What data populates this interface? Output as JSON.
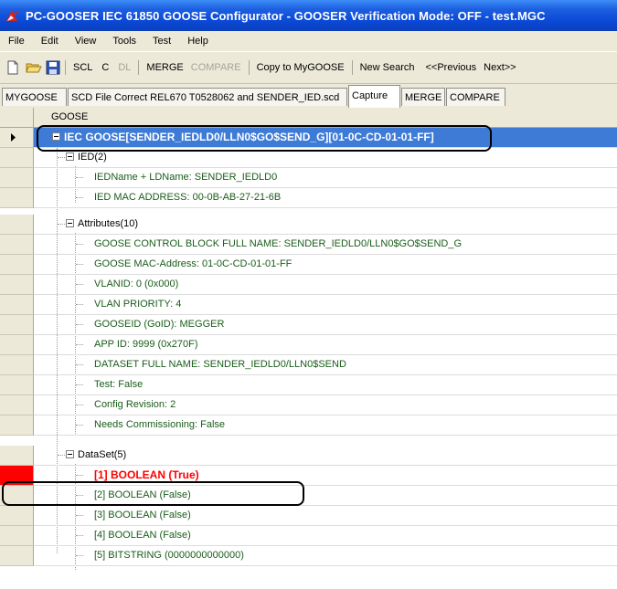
{
  "window": {
    "title": "PC-GOOSER  IEC 61850 GOOSE Configurator - GOOSER Verification Mode: OFF - test.MGC"
  },
  "menu": [
    "File",
    "Edit",
    "View",
    "Tools",
    "Test",
    "Help"
  ],
  "toolbar": {
    "scl": "SCL",
    "c": "C",
    "dl": "DL",
    "merge": "MERGE",
    "compare": "COMPARE",
    "copy": "Copy to MyGOOSE",
    "new_search": "New Search",
    "prev": "<<Previous",
    "next": "Next>>"
  },
  "tabs": [
    "MYGOOSE",
    "SCD File Correct REL670 T0528062 and SENDER_IED.scd",
    "Capture",
    "MERGE",
    "COMPARE"
  ],
  "active_tab": "Capture",
  "grid": {
    "column_header": "GOOSE",
    "root": "IEC GOOSE[SENDER_IEDLD0/LLN0$GO$SEND_G][01-0C-CD-01-01-FF]",
    "ied_group": "IED(2)",
    "ied_items": [
      "IEDName + LDName: SENDER_IEDLD0",
      "IED MAC ADDRESS: 00-0B-AB-27-21-6B"
    ],
    "attr_group": "Attributes(10)",
    "attr_items": [
      "GOOSE CONTROL BLOCK FULL NAME: SENDER_IEDLD0/LLN0$GO$SEND_G",
      "GOOSE MAC-Address: 01-0C-CD-01-01-FF",
      "VLANID: 0 (0x000)",
      "VLAN PRIORITY: 4",
      "GOOSEID (GoID): MEGGER",
      "APP ID: 9999 (0x270F)",
      "DATASET FULL NAME: SENDER_IEDLD0/LLN0$SEND",
      "Test: False",
      "Config Revision: 2",
      "Needs Commissioning: False"
    ],
    "dataset_group": "DataSet(5)",
    "dataset_items": [
      "[1] BOOLEAN   (True)",
      "[2] BOOLEAN  (False)",
      "[3] BOOLEAN  (False)",
      "[4] BOOLEAN  (False)",
      "[5] BITSTRING  (0000000000000)"
    ]
  },
  "colors": {
    "highlight": "#ff0000",
    "selection": "#3d7bd6",
    "titlebar": "#0a48d6"
  }
}
